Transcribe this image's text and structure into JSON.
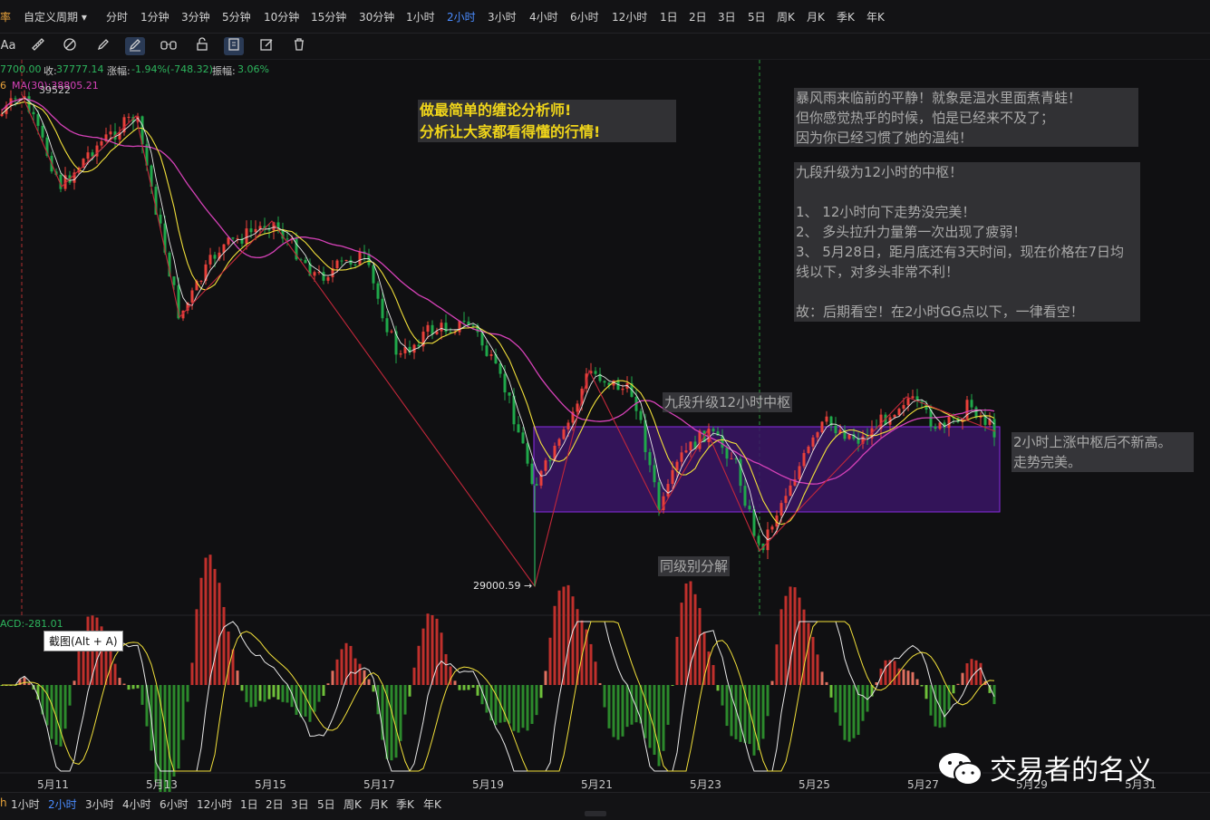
{
  "topbar": {
    "brand_fragment": "率",
    "custom_period": "自定义周期",
    "timeframes": [
      "分时",
      "1分钟",
      "3分钟",
      "5分钟",
      "10分钟",
      "15分钟",
      "30分钟",
      "1小时",
      "2小时",
      "3小时",
      "4小时",
      "6小时",
      "12小时",
      "1日",
      "2日",
      "3日",
      "5日",
      "周K",
      "月K",
      "季K",
      "年K"
    ],
    "active": "2小时"
  },
  "toolbar": {
    "icons": [
      "font-icon",
      "ruler-icon",
      "eraser-icon",
      "pencil-icon",
      "magnet-icon",
      "binoculars-icon",
      "lock-icon",
      "layer-icon",
      "edit-icon",
      "trash-icon"
    ],
    "font_label": "Aa"
  },
  "price_info": {
    "open": "7700.00",
    "close_label": "收:",
    "close": "37777.14",
    "change_label": "涨幅:",
    "change": "-1.94%(-748.32)",
    "amplitude_label": "振幅:",
    "amplitude": "3.06%",
    "ma_prefix": "6",
    "ma_text": "MA(30):38805.21",
    "high_mark": "39522",
    "low_mark": "29000.59 →"
  },
  "annotations": {
    "title_line1": "做最简单的缠论分析师!",
    "title_line2": "分析让大家都看得懂的行情!",
    "note1": "暴风雨来临前的平静！就象是温水里面煮青蛙！\n但你感觉热乎的时候，怕是已经来不及了；\n因为你已经习惯了她的温纯！",
    "note2": "九段升级为12小时的中枢！\n\n1、 12小时向下走势没完美！\n2、 多头拉升力量第一次出现了疲弱！\n3、 5月28日，距月底还有3天时间，现在价格在7日均\n线以下，对多头非常不利！\n\n故：后期看空！在2小时GG点以下，一律看空！",
    "center_label": "九段升级12小时中枢",
    "right_label_line1": "2小时上涨中枢后不新高。",
    "right_label_line2": "走势完美。",
    "decomp_label": "同级别分解"
  },
  "macd": {
    "label": "ACD:-281.01",
    "tooltip": "截图(Alt + A)"
  },
  "dates": [
    "5月11",
    "5月13",
    "5月15",
    "5月17",
    "5月19",
    "5月21",
    "5月23",
    "5月25",
    "5月27",
    "5月29",
    "5月31"
  ],
  "bottombar": {
    "timeframes": [
      "1小时",
      "2小时",
      "3小时",
      "4小时",
      "6小时",
      "12小时",
      "1日",
      "2日",
      "3日",
      "5日",
      "周K",
      "月K",
      "季K",
      "年K"
    ],
    "active": "2小时",
    "lead_fragment": "h"
  },
  "watermark": {
    "text": "交易者的名义",
    "icon": "wechat-icon"
  },
  "colors": {
    "up": "#e8403a",
    "down": "#1fa84a",
    "ma_fast": "#ffffff",
    "ma_mid": "#f2e03a",
    "ma_slow": "#d642b8",
    "zone_fill": "#3a1566",
    "zone_border": "#8a2be2",
    "active_tab": "#4a8cff"
  }
}
